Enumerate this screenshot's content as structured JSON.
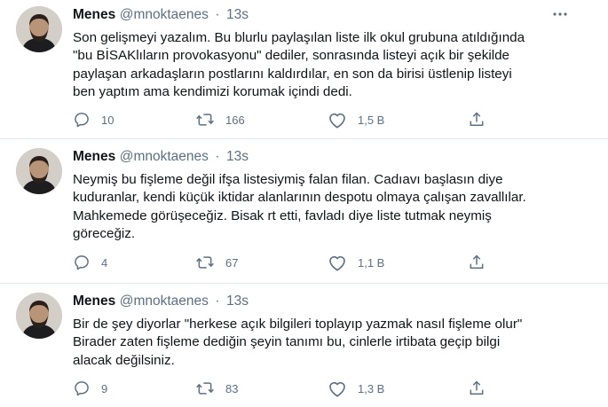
{
  "tweets": [
    {
      "author_name": "Menes",
      "author_handle": "@mnoktaenes",
      "separator": "·",
      "time": "13s",
      "text_lines": [
        "Son gelişmeyi yazalım. Bu blurlu paylaşılan liste ilk okul grubuna atıldığında",
        "\"bu BİSAKlıların provokasyonu\" dediler, sonrasında listeyi açık bir şekilde",
        "paylaşan arkadaşların postlarını kaldırdılar, en son da birisi üstlenip listeyi",
        "ben yaptım ama kendimizi korumak içindi dedi."
      ],
      "replies": "10",
      "retweets": "166",
      "likes": "1,5 B"
    },
    {
      "author_name": "Menes",
      "author_handle": "@mnoktaenes",
      "separator": "·",
      "time": "13s",
      "text_lines": [
        "Neymiş bu fişleme değil ifşa listesiymiş falan filan. Cadıavı başlasın diye",
        "kuduranlar, kendi küçük iktidar alanlarının despotu olmaya çalışan zavallılar.",
        "Mahkemede görüşeceğiz. Bisak rt etti, favladı diye liste tutmak neymiş",
        "göreceğiz."
      ],
      "replies": "4",
      "retweets": "67",
      "likes": "1,1 B"
    },
    {
      "author_name": "Menes",
      "author_handle": "@mnoktaenes",
      "separator": "·",
      "time": "13s",
      "text_lines": [
        "Bir de şey diyorlar \"herkese açık bilgileri toplayıp yazmak nasıl fişleme olur\"",
        "Birader zaten fişleme dediğin şeyin tanımı bu, cinlerle irtibata geçip bilgi",
        "alacak değilsiniz."
      ],
      "replies": "9",
      "retweets": "83",
      "likes": "1,3 B"
    }
  ],
  "icons": {
    "reply": "reply-icon",
    "retweet": "retweet-icon",
    "like": "heart-icon",
    "share": "share-icon",
    "more": "more-icon"
  },
  "colors": {
    "text": "#0f1419",
    "secondary": "#5b7083",
    "divider": "#e1e8ed"
  }
}
